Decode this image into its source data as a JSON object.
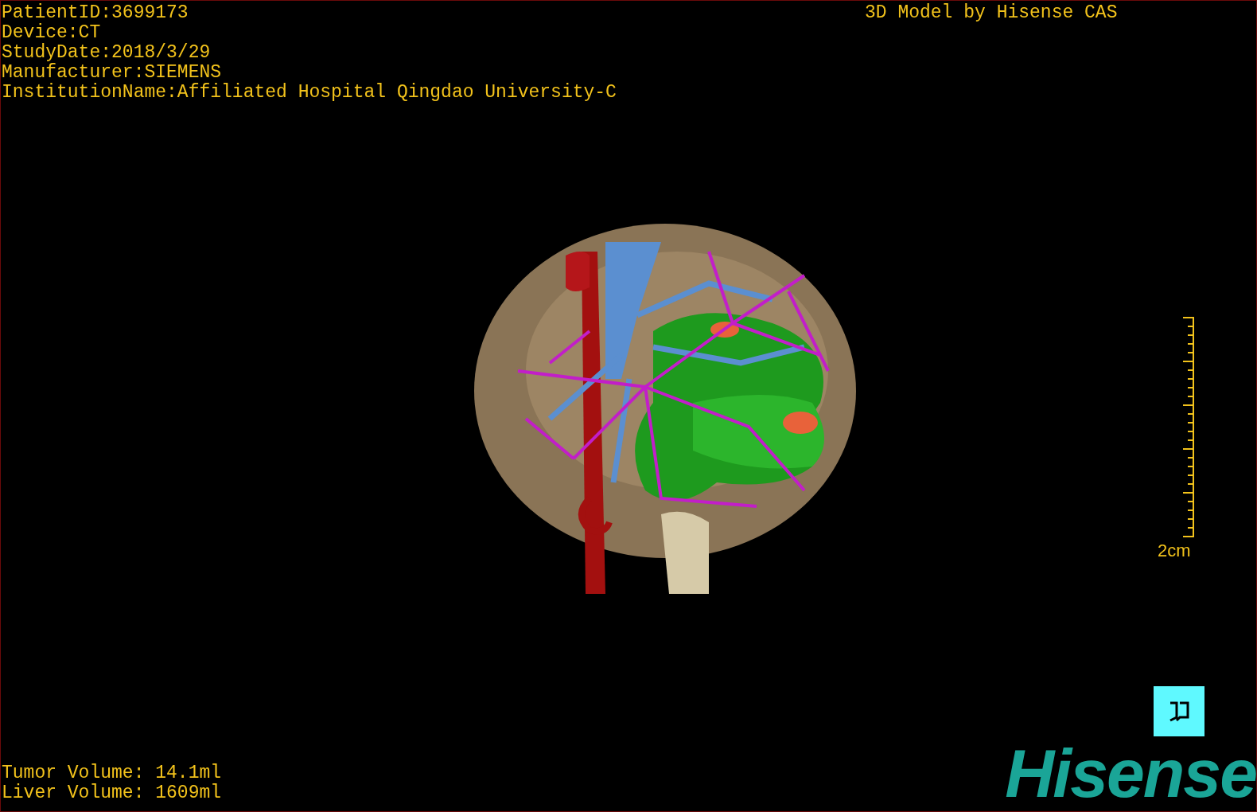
{
  "patient_info": [
    "PatientID:3699173",
    "Device:CT",
    "StudyDate:2018/3/29",
    "Manufacturer:SIEMENS",
    "InstitutionName:Affiliated Hospital Qingdao University-C"
  ],
  "model_credit": "3D Model by Hisense CAS",
  "scale_label": "2cm",
  "volumes": [
    "Tumor Volume: 14.1ml",
    "Liver Volume: 1609ml"
  ],
  "logo": "Hisense"
}
